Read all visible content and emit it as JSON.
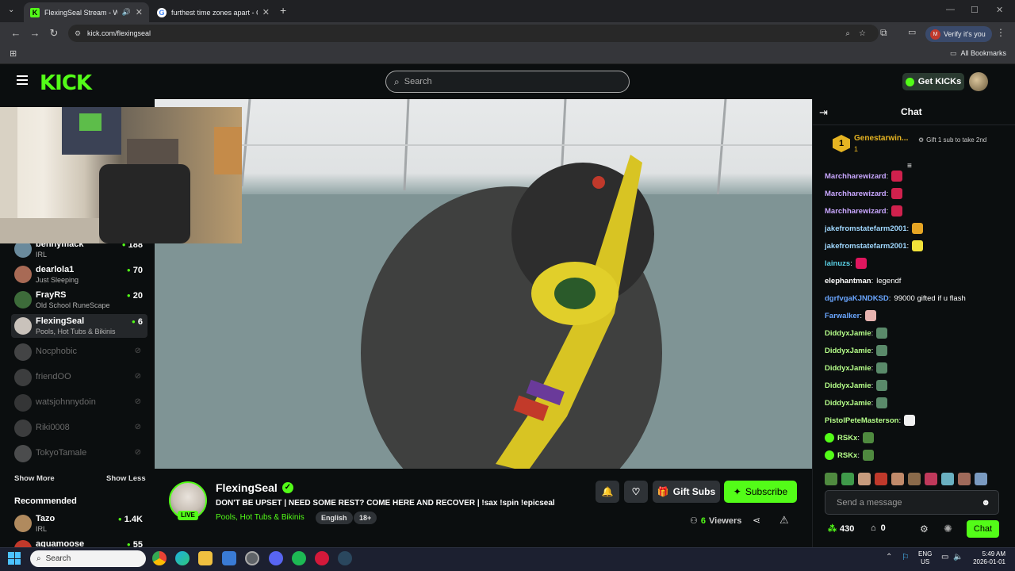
{
  "browser": {
    "tabs": [
      {
        "title": "FlexingSeal Stream - Watch",
        "active": true
      },
      {
        "title": "furthest time zones apart - Go",
        "active": false
      }
    ],
    "url": "kick.com/flexingseal",
    "verify_label": "Verify it's you",
    "verify_initial": "M",
    "all_bookmarks": "All Bookmarks"
  },
  "header": {
    "logo": "KICK",
    "search_placeholder": "Search",
    "get_kicks": "Get KICKs"
  },
  "sidebar": {
    "channels": [
      {
        "name": "bennymack",
        "category": "IRL",
        "viewers": "188",
        "avatar": "#6a8a9c"
      },
      {
        "name": "dearlola1",
        "category": "Just Sleeping",
        "viewers": "70",
        "avatar": "#a86a55"
      },
      {
        "name": "FrayRS",
        "category": "Old School RuneScape",
        "viewers": "20",
        "avatar": "#3d6b3a"
      },
      {
        "name": "FlexingSeal",
        "category": "Pools, Hot Tubs & Bikinis",
        "viewers": "6",
        "avatar": "#c9c2bb"
      }
    ],
    "offline": [
      {
        "name": "Nocphobic",
        "avatar": "#888"
      },
      {
        "name": "friendOO",
        "avatar": "#777"
      },
      {
        "name": "watsjohnnydoin",
        "avatar": "#666"
      },
      {
        "name": "Riki0008",
        "avatar": "#777"
      },
      {
        "name": "TokyoTamale",
        "avatar": "#999"
      }
    ],
    "show_more": "Show More",
    "show_less": "Show Less",
    "recommended_title": "Recommended",
    "recommended": [
      {
        "name": "Tazo",
        "category": "IRL",
        "viewers": "1.4K",
        "avatar": "#b08a5e"
      },
      {
        "name": "aquamoose",
        "category": "",
        "viewers": "55",
        "avatar": "#c0392b"
      }
    ]
  },
  "stream": {
    "streamer": "FlexingSeal",
    "live_label": "LIVE",
    "title": "DON'T BE UPSET | NEED SOME REST? COME HERE AND RECOVER | !sax !spin !epicseal",
    "category": "Pools, Hot Tubs & Bikinis",
    "tags": [
      "English",
      "18+"
    ],
    "gift_subs": "Gift Subs",
    "subscribe": "Subscribe",
    "viewers_count": "6",
    "viewers_label": "Viewers"
  },
  "chat": {
    "title": "Chat",
    "leader": {
      "rank": "1",
      "name": "Genestarwin...",
      "count": "1",
      "gift_hint": "Gift 1 sub to take 2nd"
    },
    "messages": [
      {
        "user": "Marchharewizard",
        "color": "#c9a7ff",
        "text": "",
        "emote": "#d0214d"
      },
      {
        "user": "Marchharewizard",
        "color": "#c9a7ff",
        "text": "",
        "emote": "#d0214d"
      },
      {
        "user": "Marchharewizard",
        "color": "#c9a7ff",
        "text": "",
        "emote": "#d0214d"
      },
      {
        "user": "jakefromstatefarm2001",
        "color": "#a0d8ff",
        "text": "",
        "emote": "#e6a524"
      },
      {
        "user": "jakefromstatefarm2001",
        "color": "#a0d8ff",
        "text": "",
        "emote": "#f2e23a"
      },
      {
        "user": "lainuzs",
        "color": "#5ad1e6",
        "text": "",
        "emote": "#e0165e"
      },
      {
        "user": "elephantman",
        "color": "#ffffff",
        "text": "legendf",
        "emote": ""
      },
      {
        "user": "dgrfvgaKJNDKSD",
        "color": "#6aa6ff",
        "text": "99000 gifted if u flash",
        "emote": ""
      },
      {
        "user": "Farwalker",
        "color": "#6aa6ff",
        "text": "",
        "emote": "#e8b4b0"
      },
      {
        "user": "DiddyxJamie",
        "color": "#b6ff8a",
        "text": "",
        "emote": "#5a8a6a"
      },
      {
        "user": "DiddyxJamie",
        "color": "#b6ff8a",
        "text": "",
        "emote": "#5a8a6a"
      },
      {
        "user": "DiddyxJamie",
        "color": "#b6ff8a",
        "text": "",
        "emote": "#5a8a6a"
      },
      {
        "user": "DiddyxJamie",
        "color": "#b6ff8a",
        "text": "",
        "emote": "#5a8a6a"
      },
      {
        "user": "DiddyxJamie",
        "color": "#b6ff8a",
        "text": "",
        "emote": "#5a8a6a"
      },
      {
        "user": "PistolPeteMasterson",
        "color": "#b6ff8a",
        "text": "",
        "emote": "#f0f0f0"
      },
      {
        "user": "RSKx",
        "color": "#b6ff8a",
        "text": "",
        "emote": "#4f8a3f"
      },
      {
        "user": "RSKx",
        "color": "#b6ff8a",
        "text": "",
        "emote": "#4f8a3f"
      }
    ],
    "input_placeholder": "Send a message",
    "points": "430",
    "kicks": "0",
    "send": "Chat"
  },
  "taskbar": {
    "search": "Search",
    "lang": "ENG",
    "region": "US",
    "time": "5:49 AM",
    "date": "2026-01-01"
  },
  "colors": {
    "kick_green": "#53fc18",
    "bg": "#0b0e0f"
  }
}
